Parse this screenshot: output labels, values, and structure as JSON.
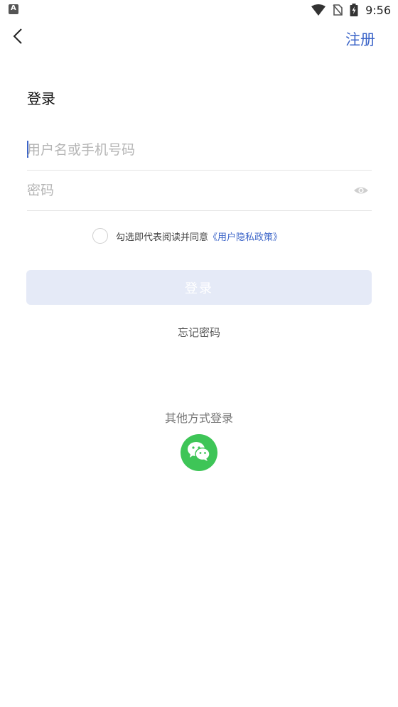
{
  "status_bar": {
    "time": "9:56",
    "icons": [
      "app-notification-icon",
      "wifi-icon",
      "no-sim-icon",
      "battery-icon"
    ]
  },
  "header": {
    "back_icon": "chevron-left-icon",
    "register_label": "注册"
  },
  "form": {
    "title": "登录",
    "username": {
      "value": "",
      "placeholder": "用户名或手机号码"
    },
    "password": {
      "value": "",
      "placeholder": "密码",
      "toggle_icon": "eye-icon"
    },
    "agreement": {
      "checked": false,
      "text": "勾选即代表阅读并同意",
      "policy_link": "《用户隐私政策》"
    },
    "login_label": "登录",
    "forgot_label": "忘记密码"
  },
  "other_login": {
    "title": "其他方式登录",
    "wechat_icon": "wechat-icon"
  },
  "colors": {
    "accent": "#3b64c8",
    "login_button_bg": "#e5eaf7",
    "wechat_green": "#3ec557"
  }
}
